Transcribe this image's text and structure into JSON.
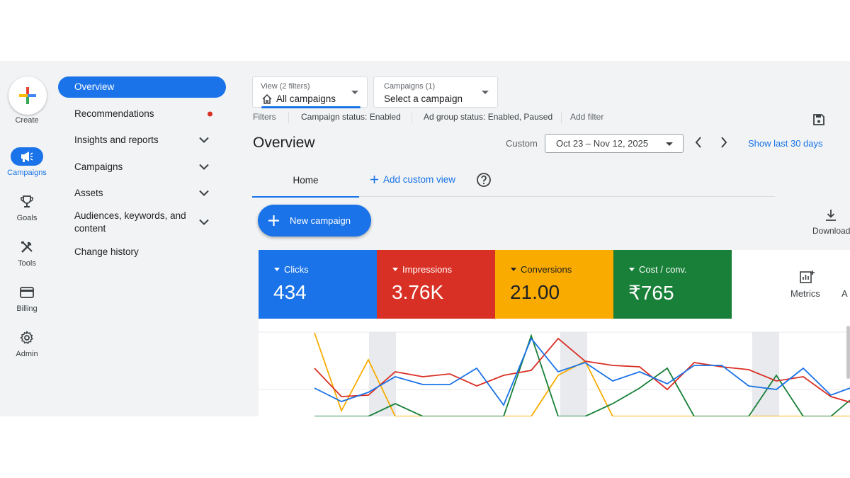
{
  "rail": {
    "create_label": "Create",
    "items": [
      {
        "label": "Campaigns",
        "icon": "megaphone-icon",
        "active": true
      },
      {
        "label": "Goals",
        "icon": "trophy-icon",
        "active": false
      },
      {
        "label": "Tools",
        "icon": "tools-icon",
        "active": false
      },
      {
        "label": "Billing",
        "icon": "credit-card-icon",
        "active": false
      },
      {
        "label": "Admin",
        "icon": "gear-icon",
        "active": false
      }
    ]
  },
  "nav": {
    "items": [
      {
        "label": "Overview",
        "active": true
      },
      {
        "label": "Recommendations",
        "badge": "red-dot"
      },
      {
        "label": "Insights and reports",
        "expandable": true
      },
      {
        "label": "Campaigns",
        "expandable": true
      },
      {
        "label": "Assets",
        "expandable": true
      },
      {
        "label_line1": "Audiences, keywords, and",
        "label_line2": "content",
        "expandable": true
      },
      {
        "label": "Change history"
      }
    ]
  },
  "view_selector": {
    "small": "View (2 filters)",
    "value": "All campaigns"
  },
  "campaign_selector": {
    "small": "Campaigns (1)",
    "value": "Select a campaign"
  },
  "filters": {
    "label": "Filters",
    "chips": [
      "Campaign status: Enabled",
      "Ad group status: Enabled, Paused"
    ],
    "add": "Add filter"
  },
  "header": {
    "title": "Overview",
    "custom_label": "Custom",
    "date_range": "Oct 23 – Nov 12, 2025",
    "show_last": "Show last 30 days"
  },
  "tabs": {
    "home": "Home",
    "add_custom_view": "Add custom view"
  },
  "new_campaign": "New campaign",
  "download": "Download",
  "metrics": {
    "cards": [
      {
        "name": "Clicks",
        "value": "434",
        "color": "#1a73e8"
      },
      {
        "name": "Impressions",
        "value": "3.76K",
        "color": "#d93025"
      },
      {
        "name": "Conversions",
        "value": "21.00",
        "color": "#f9ab00"
      },
      {
        "name": "Cost / conv.",
        "value": "₹765",
        "color": "#188038"
      }
    ],
    "metrics_label": "Metrics",
    "extra": "A"
  },
  "colors": {
    "accent": "#1a73e8",
    "red": "#d93025",
    "yellow": "#f9ab00",
    "green": "#188038"
  }
}
